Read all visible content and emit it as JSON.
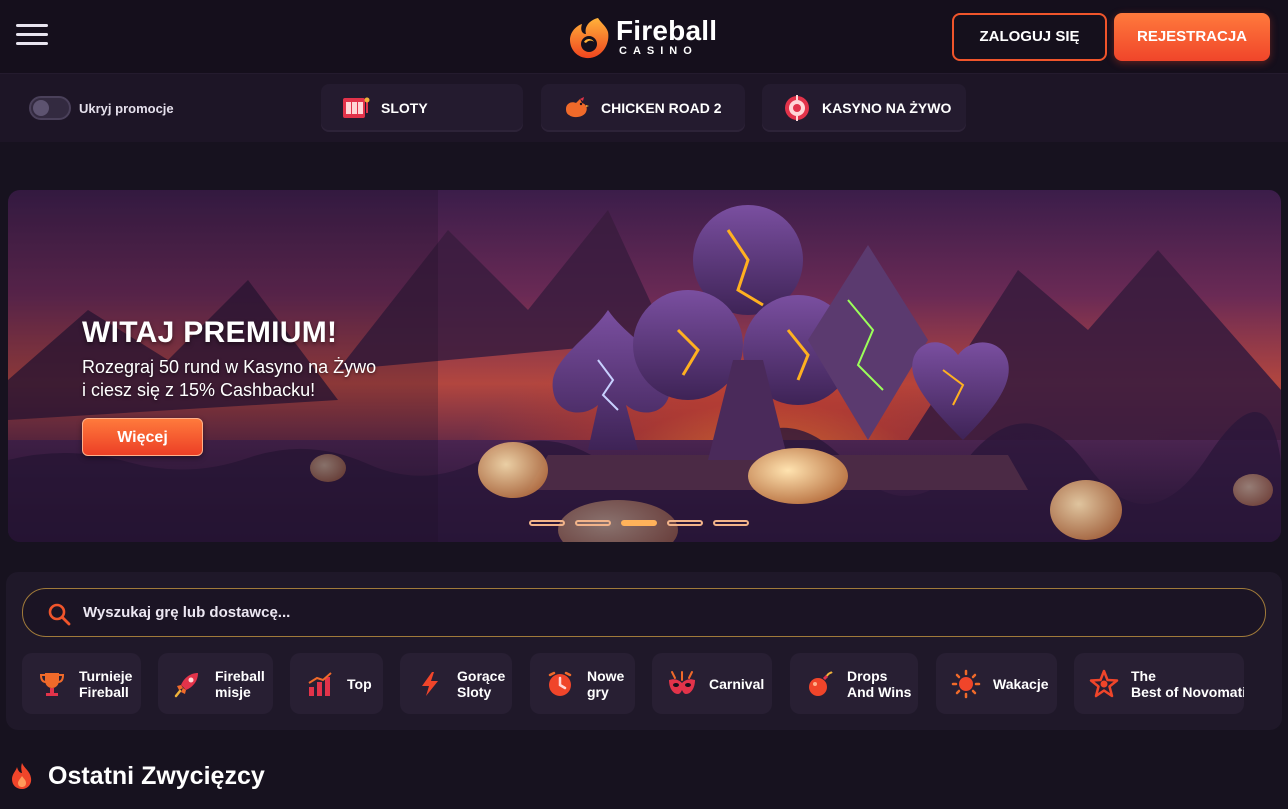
{
  "header": {
    "logo_word": "Fireball",
    "logo_sub": "CASINO",
    "login_label": "ZALOGUJ SIĘ",
    "register_label": "REJESTRACJA"
  },
  "catbar": {
    "toggle_label": "Ukryj promocje",
    "items": [
      {
        "label": "SLOTY",
        "icon": "slots-icon"
      },
      {
        "label": "CHICKEN ROAD 2",
        "icon": "chicken-icon"
      },
      {
        "label": "KASYNO NA ŻYWO",
        "icon": "roulette-icon"
      }
    ]
  },
  "banner": {
    "title": "WITAJ PREMIUM!",
    "subtitle_line1": "Rozegraj 50 rund w Kasyno na Żywo",
    "subtitle_line2": "i ciesz się z 15% Cashbacku!",
    "button_label": "Więcej",
    "slide_count": 5,
    "active_slide": 3
  },
  "search": {
    "placeholder": "Wyszukaj grę lub dostawcę..."
  },
  "chips": [
    {
      "line1": "Turnieje",
      "line2": "Fireball",
      "icon": "trophy-icon"
    },
    {
      "line1": "Fireball",
      "line2": "misje",
      "icon": "rocket-icon"
    },
    {
      "line1": "Top",
      "line2": "",
      "icon": "chart-icon"
    },
    {
      "line1": "Gorące",
      "line2": "Sloty",
      "icon": "lightning-icon"
    },
    {
      "line1": "Nowe",
      "line2": "gry",
      "icon": "clock-icon"
    },
    {
      "line1": "Carnival",
      "line2": "",
      "icon": "mask-icon"
    },
    {
      "line1": "Drops",
      "line2": "And Wins",
      "icon": "bomb-icon"
    },
    {
      "line1": "Wakacje",
      "line2": "",
      "icon": "sun-icon"
    },
    {
      "line1": "The",
      "line2": "Best of Novomatic",
      "icon": "star-icon"
    }
  ],
  "section": {
    "title": "Ostatni Zwycięzcy"
  },
  "colors": {
    "accent": "#f0552b",
    "background": "#17121f",
    "panel": "#1f1829"
  }
}
